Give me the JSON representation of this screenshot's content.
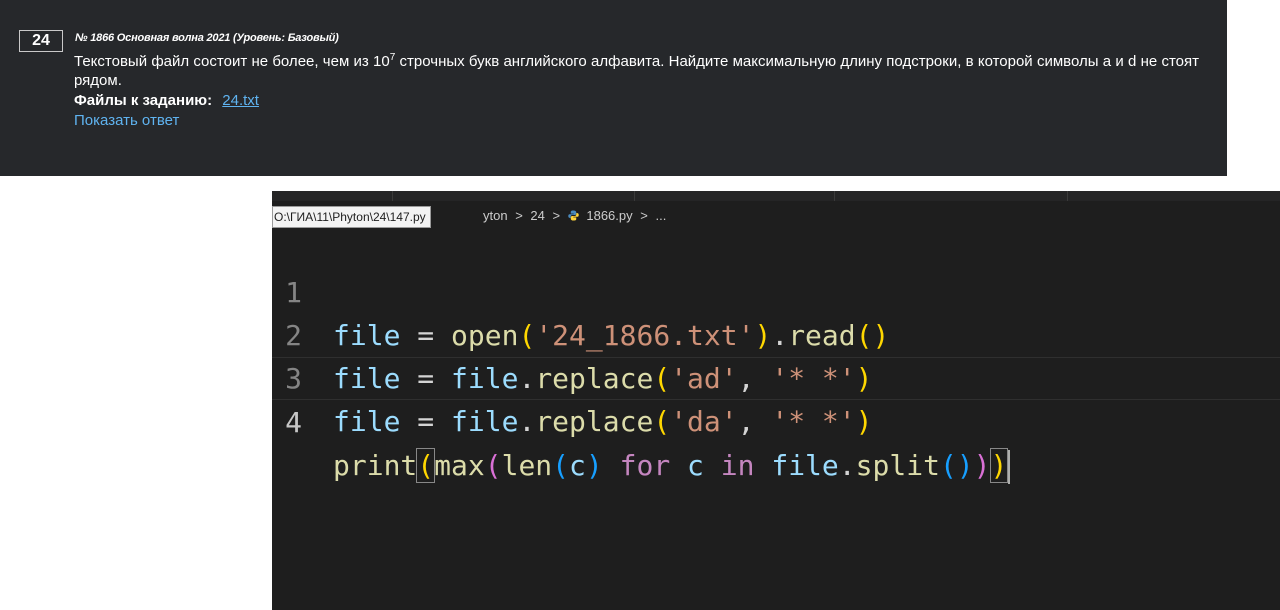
{
  "task": {
    "number": "24",
    "meta": "№ 1866 Основная волна 2021 (Уровень: Базовый)",
    "text_before": "Текстовый файл состоит не более, чем из 10",
    "text_sup": "7",
    "text_after": " строчных букв английского алфавита. Найдите максимальную длину подстроки, в которой символы a и d не стоят рядом.",
    "files_label": "Файлы к заданию:",
    "file_link": "24.txt",
    "show_answer": "Показать ответ"
  },
  "editor": {
    "tooltip_path": "O:\\ГИА\\11\\Phyton\\24\\147.py",
    "breadcrumb": {
      "part1": "yton",
      "sep": ">",
      "part2": "24",
      "file": "1866.py",
      "ellipsis": "..."
    },
    "line_numbers": [
      "1",
      "2",
      "3",
      "4"
    ],
    "code": {
      "l1": {
        "var": "file",
        "eq": " = ",
        "fn": "open",
        "p1": "(",
        "str": "'24_1866.txt'",
        "p2": ")",
        "dot": ".",
        "fn2": "read",
        "p3": "()"
      },
      "l2": {
        "var": "file",
        "eq": " = ",
        "obj": "file",
        "dot": ".",
        "fn": "replace",
        "p1": "(",
        "s1": "'ad'",
        "comma": ", ",
        "s2": "'* *'",
        "p2": ")"
      },
      "l3": {
        "var": "file",
        "eq": " = ",
        "obj": "file",
        "dot": ".",
        "fn": "replace",
        "p1": "(",
        "s1": "'da'",
        "comma": ", ",
        "s2": "'* *'",
        "p2": ")"
      },
      "l4": {
        "fn": "print",
        "p1": "(",
        "fn2": "max",
        "p2": "(",
        "fn3": "len",
        "p3": "(",
        "v1": "c",
        "p3c": ")",
        "kw1": " for ",
        "v2": "c",
        "kw2": " in ",
        "obj": "file",
        "dot": ".",
        "fn4": "split",
        "p4": "()",
        "p2c": ")",
        "p1c": ")"
      }
    },
    "colors": {
      "background": "#1e1e1e",
      "variable": "#9cdcfe",
      "function": "#dcdcaa",
      "string": "#ce9178",
      "keyword": "#c586c0",
      "bracket_1": "#ffd700",
      "bracket_2": "#da70d6",
      "bracket_3": "#179fff"
    }
  }
}
